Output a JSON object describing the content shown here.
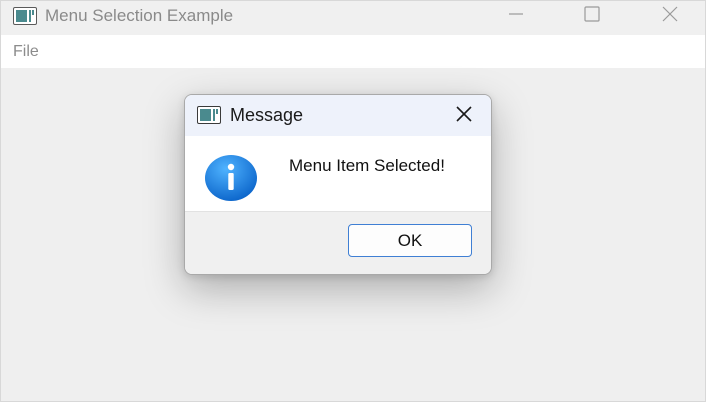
{
  "window": {
    "title": "Menu Selection Example",
    "icon": "app-window-icon",
    "controls": {
      "minimize": "minimize-icon",
      "maximize": "maximize-icon",
      "close": "close-icon"
    }
  },
  "menubar": {
    "items": [
      "File"
    ]
  },
  "dialog": {
    "title": "Message",
    "icon": "app-window-icon",
    "message_icon": "info-icon",
    "message": "Menu Item Selected!",
    "ok_label": "OK",
    "colors": {
      "accent": "#1a73d9",
      "button_border": "#3f7fd4"
    }
  }
}
